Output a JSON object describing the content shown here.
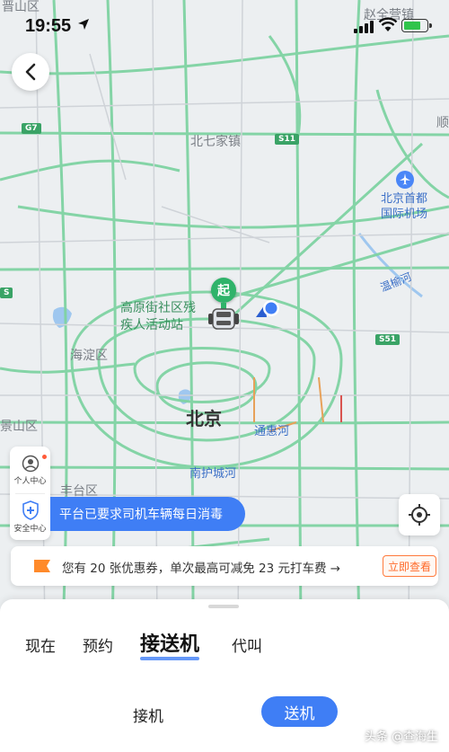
{
  "status_bar": {
    "time": "19:55"
  },
  "map": {
    "labels": {
      "top_left_cut": "晋山区",
      "top_right": "赵全营镇",
      "beiqijia": "北七家镇",
      "airport": "北京首都\n国际机场",
      "gaoyuan": "高原街社区残\n疾人活动站",
      "haidian": "海淀区",
      "beijing": "北京",
      "shijingshan": "景山区",
      "tonghui_river": "通惠河",
      "nanhu_river": "南护城河",
      "fengtai": "丰台区",
      "wenyu_river": "温榆河",
      "right_cut": "顺"
    },
    "road_shields": {
      "g7": "G7",
      "s11": "S11",
      "s51": "S51",
      "left_s": "S"
    },
    "start_marker": "起",
    "colors": {
      "road": "#7fd3a2",
      "highway": "#6ccf96",
      "water": "#9fc7ef",
      "bg": "#eceff1"
    }
  },
  "side_buttons": {
    "personal_center": "个人中心",
    "safety_center": "安全中心"
  },
  "notice": {
    "text": "平台已要求司机车辆每日消毒"
  },
  "coupon": {
    "text": "您有 20 张优惠券，单次最高可减免 23 元打车费 →",
    "button": "立即查看"
  },
  "sheet": {
    "tabs": [
      "现在",
      "预约",
      "接送机",
      "代叫"
    ],
    "active_tab": "接送机",
    "sub_tabs": {
      "pickup": "接机",
      "dropoff": "送机"
    }
  },
  "watermark": "头条 @查海生"
}
